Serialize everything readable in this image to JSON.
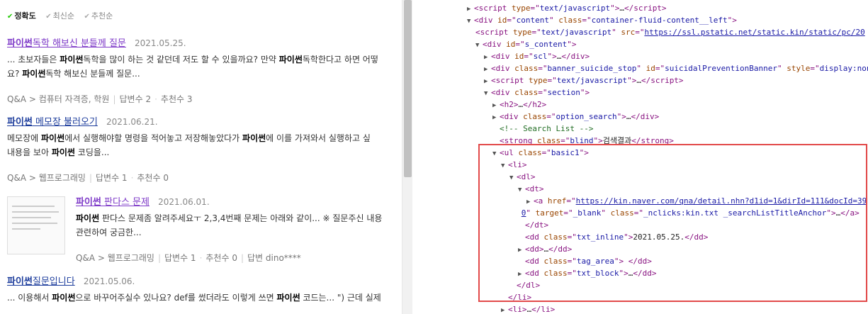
{
  "sort_bar": {
    "options": [
      {
        "label": "정확도",
        "active": true
      },
      {
        "label": "최신순",
        "active": false
      },
      {
        "label": "추천순",
        "active": false
      }
    ]
  },
  "results": [
    {
      "title_hl": "파이썬",
      "title_rest": "독학 해보신 분들께 질문",
      "date": "2021.05.25.",
      "snippet1": "... 초보자들은 파이썬독학을 많이 하는 것 같던데 저도 할 수 있을까요? 만약 파이썬독학한다고 하면 어떻",
      "snippet2": "요? 파이썬독학 해보신 분들께 질문...",
      "category": "Q&A > 컴퓨터 자격증, 학원",
      "answers": "답변수 2",
      "recommends": "추천수 3"
    },
    {
      "title_hl": "파이썬",
      "title_rest": " 메모장 불러오기",
      "date": "2021.06.21.",
      "snippet1": "메모장에 파이썬에서 실행해야할 명령을 적어놓고 저장해놓았다가 파이썬에 이를 가져와서 실행하고 싶",
      "snippet2": "내용을 보아 파이썬 코딩을...",
      "category": "Q&A > 웹프로그래밍",
      "answers": "답변수 1",
      "recommends": "추천수 0"
    },
    {
      "title_hl": "파이썬",
      "title_rest": " 판다스 문제",
      "date": "2021.06.01.",
      "snippet1": "파이썬 판다스 문제좀 알려주세요ㅜ 2,3,4번째 문제는 아래와 같이... ※ 질문주신 내용",
      "snippet2": "관련하여 궁금한...",
      "category": "Q&A > 웹프로그래밍",
      "answers": "답변수 1",
      "recommends": "추천수 0",
      "answerer": "답변 dino****"
    },
    {
      "title_hl": "파이썬",
      "title_rest": "질문입니다",
      "date": "2021.05.06.",
      "snippet1": "... 이용해서 파이썬으로 바꾸어주실수 있나요? def를 썼더라도 이렇게 쓰면 파이썬 코드는... \") 근데 실제"
    }
  ],
  "devtools": {
    "lines": [
      {
        "indent": 0,
        "html": "<span class='tri'>▶</span><span class='tag'>&lt;script</span> <span class='an'>type</span>=\"<span class='av'>text/javascript</span>\"<span class='tag'>&gt;</span><span class='txt'>…</span><span class='tag'>&lt;/script&gt;</span>"
      },
      {
        "indent": 0,
        "html": "<span class='tri'>▼</span><span class='tag'>&lt;div</span> <span class='an'>id</span>=\"<span class='av'>content</span>\" <span class='an'>class</span>=\"<span class='av'>container-fluid-content__left</span>\"<span class='tag'>&gt;</span>"
      },
      {
        "indent": 1,
        "html": "<span class='tag'>&lt;script</span> <span class='an'>type</span>=\"<span class='av'>text/javascript</span>\" <span class='an'>src</span>=\"<span class='lnk'>https://ssl.pstatic.net/static.kin/static/pc/20</span>"
      },
      {
        "indent": 1,
        "html": "<span class='tri'>▼</span><span class='tag'>&lt;div</span> <span class='an'>id</span>=\"<span class='av'>s_content</span>\"<span class='tag'>&gt;</span>"
      },
      {
        "indent": 2,
        "html": "<span class='tri'>▶</span><span class='tag'>&lt;div</span> <span class='an'>id</span>=\"<span class='av'>scl</span>\"<span class='tag'>&gt;</span><span class='txt'>…</span><span class='tag'>&lt;/div&gt;</span>"
      },
      {
        "indent": 2,
        "html": "<span class='tri'>▶</span><span class='tag'>&lt;div</span> <span class='an'>class</span>=\"<span class='av'>banner_suicide_stop</span>\" <span class='an'>id</span>=\"<span class='av'>suicidalPreventionBanner</span>\" <span class='an'>style</span>=\"<span class='av'>display:non</span>"
      },
      {
        "indent": 2,
        "html": "<span class='tri'>▶</span><span class='tag'>&lt;script</span> <span class='an'>type</span>=\"<span class='av'>text/javascript</span>\"<span class='tag'>&gt;</span><span class='txt'>…</span><span class='tag'>&lt;/script&gt;</span>"
      },
      {
        "indent": 2,
        "html": "<span class='tri'>▼</span><span class='tag'>&lt;div</span> <span class='an'>class</span>=\"<span class='av'>section</span>\"<span class='tag'>&gt;</span>"
      },
      {
        "indent": 3,
        "html": "<span class='tri'>▶</span><span class='tag'>&lt;h2&gt;</span><span class='txt'>…</span><span class='tag'>&lt;/h2&gt;</span>"
      },
      {
        "indent": 3,
        "html": "<span class='tri'>▶</span><span class='tag'>&lt;div</span> <span class='an'>class</span>=\"<span class='av'>option_search</span>\"<span class='tag'>&gt;</span><span class='txt'>…</span><span class='tag'>&lt;/div&gt;</span>"
      },
      {
        "indent": 3,
        "html": "<span class='tri'></span><span class='cmt'>&lt;!-- Search List --&gt;</span>"
      },
      {
        "indent": 3,
        "html": "<span class='tri'></span><span class='tag'>&lt;strong</span> <span class='an'>class</span>=\"<span class='av'>blind</span>\"<span class='tag'>&gt;</span><span class='txt'>검색결과</span><span class='tag'>&lt;/strong&gt;</span>"
      },
      {
        "indent": 3,
        "html": "<span class='tri'>▼</span><span class='tag'>&lt;ul</span> <span class='an'>class</span>=\"<span class='av'>basic1</span>\"<span class='tag'>&gt;</span>"
      },
      {
        "indent": 4,
        "html": "<span class='tri'>▼</span><span class='tag'>&lt;li&gt;</span>"
      },
      {
        "indent": 5,
        "html": "<span class='tri'>▼</span><span class='tag'>&lt;dl&gt;</span>"
      },
      {
        "indent": 6,
        "html": "<span class='tri'>▼</span><span class='tag'>&lt;dt&gt;</span>"
      },
      {
        "indent": 7,
        "html": "<span class='tri'>▶</span><span class='tag'>&lt;a</span> <span class='an'>href</span>=\"<span class='lnk'>https://kin.naver.com/qna/detail.nhn?d1id=1&amp;dirId=111&amp;docId=39</span>"
      },
      {
        "indent": 6.4,
        "html": "<span class='lnk'>0</span>\" <span class='an'>target</span>=\"<span class='av'>_blank</span>\" <span class='an'>class</span>=\"<span class='av'>_nclicks:kin.txt _searchListTitleAnchor</span>\"<span class='tag'>&gt;</span><span class='txt'>…</span><span class='tag'>&lt;/a&gt;</span>"
      },
      {
        "indent": 6,
        "html": "<span class='tri'></span><span class='tag'>&lt;/dt&gt;</span>"
      },
      {
        "indent": 6,
        "html": "<span class='tri'></span><span class='tag'>&lt;dd</span> <span class='an'>class</span>=\"<span class='av'>txt_inline</span>\"<span class='tag'>&gt;</span><span class='txt'>2021.05.25.</span><span class='tag'>&lt;/dd&gt;</span>"
      },
      {
        "indent": 6,
        "html": "<span class='tri'>▶</span><span class='tag'>&lt;dd&gt;</span><span class='txt'>…</span><span class='tag'>&lt;/dd&gt;</span>"
      },
      {
        "indent": 6,
        "html": "<span class='tri'></span><span class='tag'>&lt;dd</span> <span class='an'>class</span>=\"<span class='av'>tag_area</span>\"<span class='tag'>&gt;</span> <span class='tag'>&lt;/dd&gt;</span>"
      },
      {
        "indent": 6,
        "html": "<span class='tri'>▶</span><span class='tag'>&lt;dd</span> <span class='an'>class</span>=\"<span class='av'>txt_block</span>\"<span class='tag'>&gt;</span><span class='txt'>…</span><span class='tag'>&lt;/dd&gt;</span>"
      },
      {
        "indent": 5,
        "html": "<span class='tri'></span><span class='tag'>&lt;/dl&gt;</span>"
      },
      {
        "indent": 4,
        "html": "<span class='tri'></span><span class='tag'>&lt;/li&gt;</span>"
      },
      {
        "indent": 4,
        "html": "<span class='tri'>▶</span><span class='tag'>&lt;li&gt;</span><span class='txt'>…</span><span class='tag'>&lt;/li&gt;</span>"
      }
    ]
  }
}
